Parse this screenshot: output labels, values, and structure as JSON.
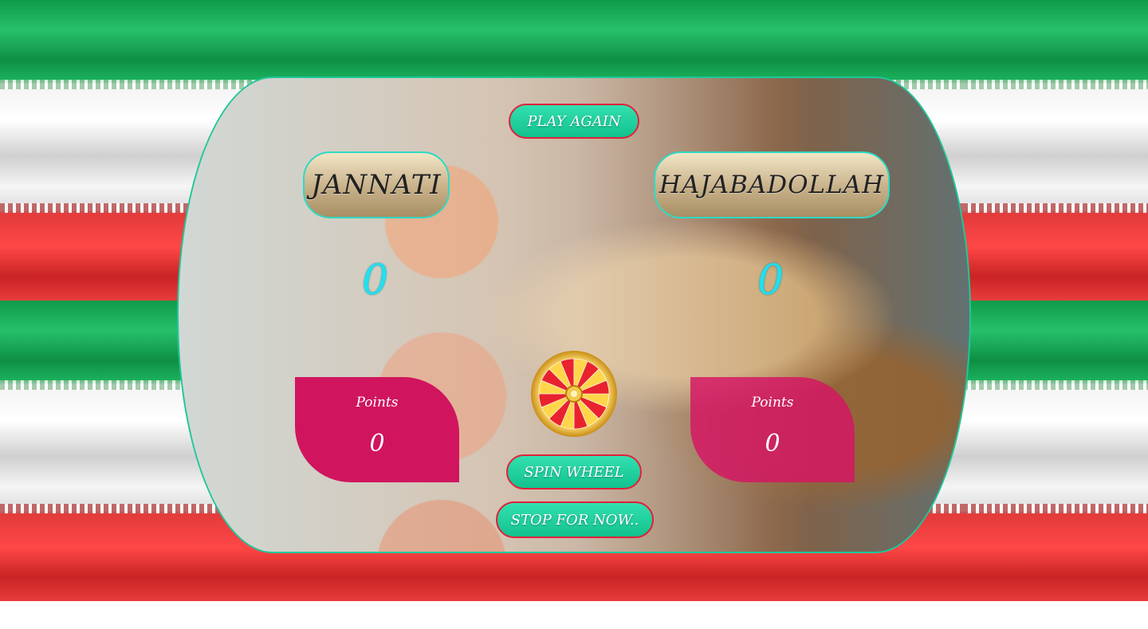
{
  "buttons": {
    "play_again": "PLAY AGAIN",
    "spin_wheel": "SPIN WHEEL",
    "stop_for_now": "STOP FOR NOW.."
  },
  "players": [
    {
      "name": "JANNATI",
      "turn_score": "0",
      "points_label": "Points",
      "points": "0"
    },
    {
      "name": "HAJABADOLLAH",
      "turn_score": "0",
      "points_label": "Points",
      "points": "0"
    }
  ],
  "colors": {
    "button_fill": "#1fcf9c",
    "button_border": "#e0213a",
    "points_box": "#d0155e",
    "turn_score": "#1fe0f0",
    "board_border": "#1fc79a"
  },
  "icons": {
    "wheel": "prize-wheel-icon"
  }
}
